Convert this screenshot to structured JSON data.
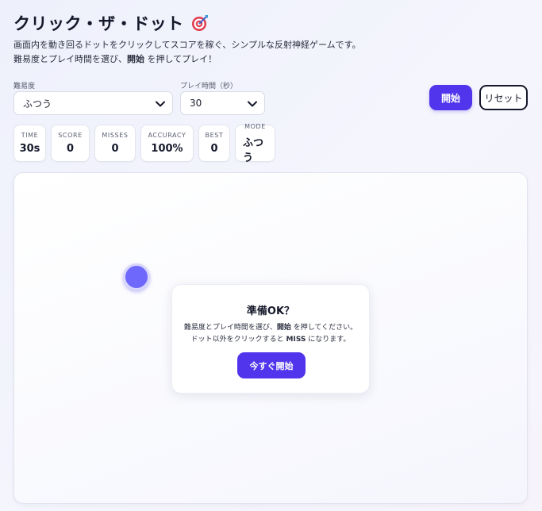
{
  "header": {
    "title": "クリック・ザ・ドット",
    "title_icon": "target-dart-icon",
    "desc_line1": "画面内を動き回るドットをクリックしてスコアを稼ぐ、シンプルな反射神経ゲームです。",
    "desc_line2_pre": "難易度とプレイ時間を選び、",
    "desc_line2_bold": "開始",
    "desc_line2_post": " を押してプレイ！"
  },
  "controls": {
    "difficulty_label": "難易度",
    "difficulty_value": "ふつう",
    "time_label": "プレイ時間（秒）",
    "time_value": "30",
    "start_label": "開始",
    "reset_label": "リセット"
  },
  "stats": [
    {
      "key": "time",
      "label": "TIME",
      "value": "30s"
    },
    {
      "key": "score",
      "label": "SCORE",
      "value": "0"
    },
    {
      "key": "misses",
      "label": "MISSES",
      "value": "0"
    },
    {
      "key": "accuracy",
      "label": "ACCURACY",
      "value": "100%"
    },
    {
      "key": "best",
      "label": "BEST",
      "value": "0"
    },
    {
      "key": "mode",
      "label": "MODE",
      "value": "ふつう"
    }
  ],
  "modal": {
    "title": "準備OK？",
    "line1_pre": "難易度とプレイ時間を選び、",
    "line1_bold": "開始",
    "line1_post": " を押してください。",
    "line2_pre": "ドット以外をクリックすると ",
    "line2_bold": "MISS",
    "line2_post": " になります。",
    "button_label": "今すぐ開始"
  },
  "colors": {
    "accent": "#5135ec",
    "dot": "#6f68fc"
  }
}
